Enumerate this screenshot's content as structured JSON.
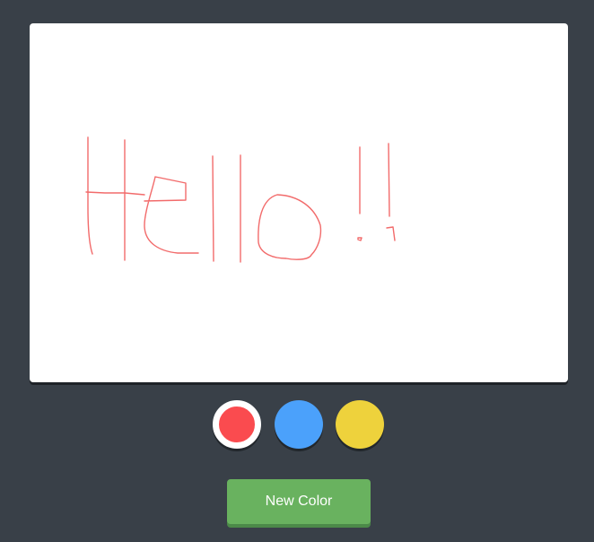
{
  "drawing": {
    "stroke_color": "#f26b6b"
  },
  "palette": {
    "swatches": [
      {
        "name": "red",
        "color": "#fa4b4f",
        "selected": true
      },
      {
        "name": "blue",
        "color": "#4ba1fb",
        "selected": false
      },
      {
        "name": "yellow",
        "color": "#eed23c",
        "selected": false
      }
    ]
  },
  "controls": {
    "new_color_label": "New Color",
    "new_color_bg": "#69b25f"
  }
}
